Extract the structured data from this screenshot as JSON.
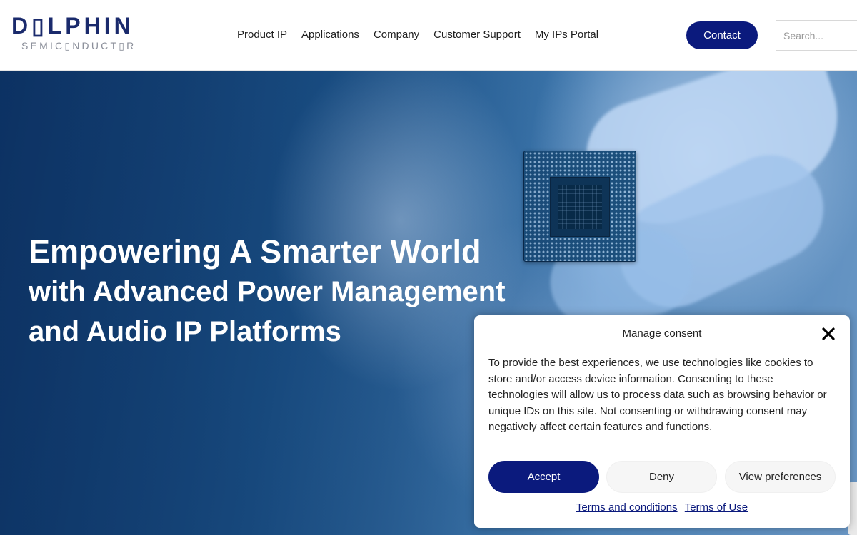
{
  "header": {
    "logo_main": "D▯LPHIN",
    "logo_sub": "SEMIC▯NDUCT▯R",
    "nav": [
      "Product IP",
      "Applications",
      "Company",
      "Customer Support",
      "My IPs Portal"
    ],
    "contact_label": "Contact",
    "search_placeholder": "Search..."
  },
  "hero": {
    "line1": "Empowering A Smarter World",
    "line2": "with Advanced Power Management",
    "line3": "and Audio IP Platforms"
  },
  "consent": {
    "title": "Manage consent",
    "body": "To provide the best experiences, we use technologies like cookies to store and/or access device information. Consenting to these technologies will allow us to process data such as browsing behavior or unique IDs on this site. Not consenting or withdrawing consent may negatively affect certain features and functions.",
    "accept_label": "Accept",
    "deny_label": "Deny",
    "prefs_label": "View preferences",
    "terms_label": "Terms and conditions",
    "terms_of_use_label": "Terms of Use"
  },
  "colors": {
    "brand_navy": "#0b1a7d",
    "logo_navy": "#1a2a6c"
  },
  "icons": [
    "close-icon"
  ]
}
